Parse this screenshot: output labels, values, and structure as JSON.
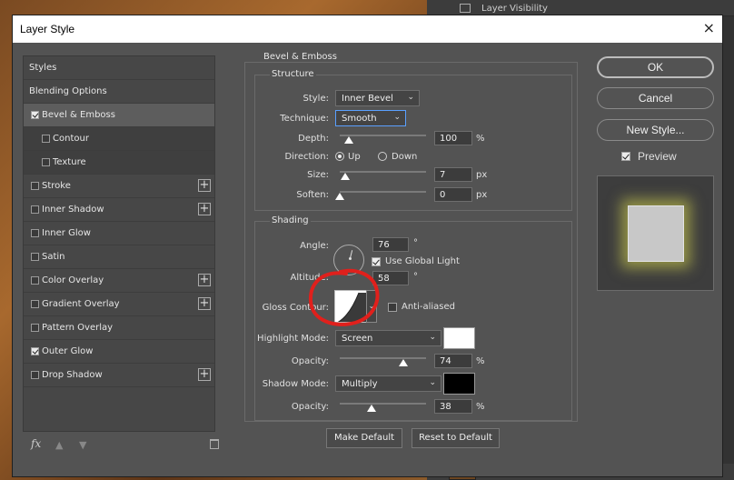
{
  "background": {
    "layers_panel_row_label": "Layer Visibility"
  },
  "dialog": {
    "title": "Layer Style",
    "close_symbol": "×"
  },
  "left_list": {
    "items": [
      {
        "label": "Styles",
        "checkbox": null,
        "plus": false,
        "selected": false
      },
      {
        "label": "Blending Options",
        "checkbox": null,
        "plus": false,
        "selected": false
      },
      {
        "label": "Bevel & Emboss",
        "checkbox": true,
        "plus": false,
        "selected": true
      },
      {
        "label": "Contour",
        "checkbox": false,
        "plus": false,
        "sub": true
      },
      {
        "label": "Texture",
        "checkbox": false,
        "plus": false,
        "sub": true
      },
      {
        "label": "Stroke",
        "checkbox": false,
        "plus": true
      },
      {
        "label": "Inner Shadow",
        "checkbox": false,
        "plus": true
      },
      {
        "label": "Inner Glow",
        "checkbox": false,
        "plus": false
      },
      {
        "label": "Satin",
        "checkbox": false,
        "plus": false
      },
      {
        "label": "Color Overlay",
        "checkbox": false,
        "plus": true
      },
      {
        "label": "Gradient Overlay",
        "checkbox": false,
        "plus": true
      },
      {
        "label": "Pattern Overlay",
        "checkbox": false,
        "plus": false
      },
      {
        "label": "Outer Glow",
        "checkbox": true,
        "plus": false
      },
      {
        "label": "Drop Shadow",
        "checkbox": false,
        "plus": true
      }
    ],
    "fx_label": "fx"
  },
  "bevel": {
    "section_title": "Bevel & Emboss",
    "structure_title": "Structure",
    "style_label": "Style:",
    "style_value": "Inner Bevel",
    "technique_label": "Technique:",
    "technique_value": "Smooth",
    "depth_label": "Depth:",
    "depth_value": "100",
    "depth_unit": "%",
    "depth_fraction": 0.1,
    "direction_label": "Direction:",
    "direction_up": "Up",
    "direction_down": "Down",
    "direction_selected": "Up",
    "size_label": "Size:",
    "size_value": "7",
    "size_unit": "px",
    "soften_label": "Soften:",
    "soften_value": "0",
    "soften_unit": "px"
  },
  "shading": {
    "title": "Shading",
    "angle_label": "Angle:",
    "angle_value": "76",
    "angle_unit": "°",
    "use_global_light_label": "Use Global Light",
    "use_global_light": true,
    "altitude_label": "Altitude:",
    "altitude_value": "58",
    "altitude_unit": "°",
    "gloss_contour_label": "Gloss Contour:",
    "anti_aliased_label": "Anti-aliased",
    "anti_aliased": false,
    "highlight_mode_label": "Highlight Mode:",
    "highlight_mode_value": "Screen",
    "highlight_color": "#ffffff",
    "highlight_opacity_label": "Opacity:",
    "highlight_opacity_value": "74",
    "highlight_opacity_unit": "%",
    "shadow_mode_label": "Shadow Mode:",
    "shadow_mode_value": "Multiply",
    "shadow_color": "#000000",
    "shadow_opacity_label": "Opacity:",
    "shadow_opacity_value": "38",
    "shadow_opacity_unit": "%"
  },
  "footer_buttons": {
    "make_default": "Make Default",
    "reset_to_default": "Reset to Default"
  },
  "right_buttons": {
    "ok": "OK",
    "cancel": "Cancel",
    "new_style": "New Style...",
    "preview_label": "Preview",
    "preview_checked": true
  },
  "colors": {
    "annotation_circle": "#e0201c",
    "glow": "#dcdc50"
  }
}
